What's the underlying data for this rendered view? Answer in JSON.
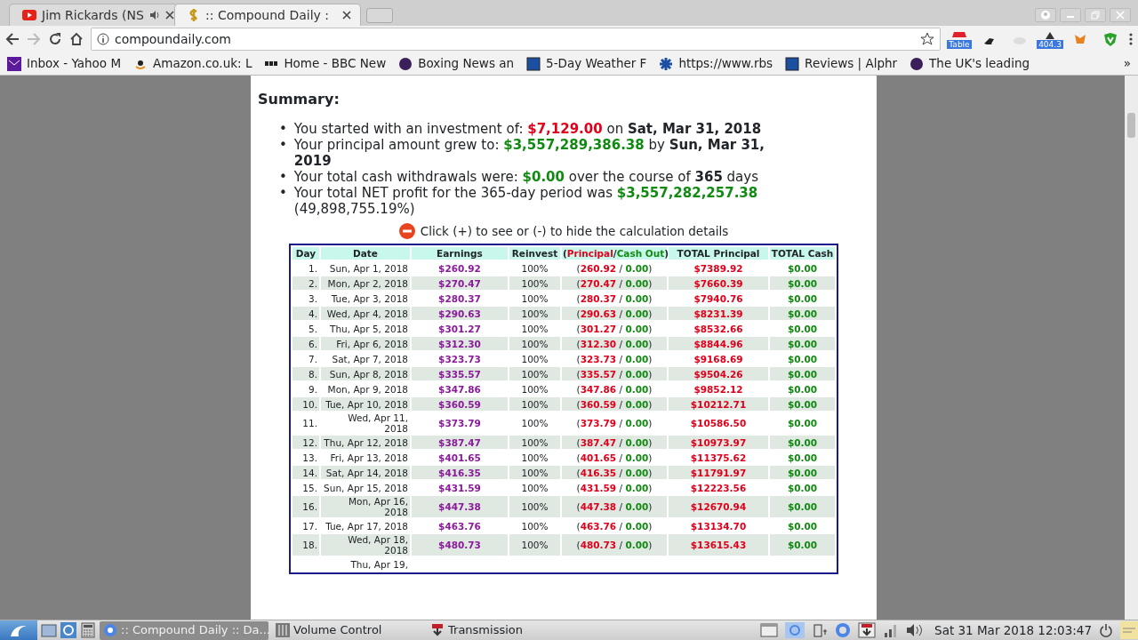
{
  "browser": {
    "tabs": [
      {
        "title": "Jim Rickards (NS",
        "selected": false,
        "kind": "video",
        "audio": true
      },
      {
        "title": ":: Compound Daily :",
        "selected": true,
        "kind": "dollar",
        "audio": false
      }
    ],
    "address": "compoundaily.com",
    "extension_badges": [
      "Table",
      "404.3"
    ],
    "bookmarks": [
      {
        "title": "Inbox - Yahoo M",
        "kind": "mail"
      },
      {
        "title": "Amazon.co.uk: L",
        "kind": "amazon"
      },
      {
        "title": "Home - BBC New",
        "kind": "bbc"
      },
      {
        "title": "Boxing News an",
        "kind": "round"
      },
      {
        "title": "5-Day Weather F",
        "kind": "square"
      },
      {
        "title": "https://www.rbs",
        "kind": "star"
      },
      {
        "title": "Reviews | Alphr",
        "kind": "square"
      },
      {
        "title": "The UK's leading",
        "kind": "round"
      }
    ],
    "more": "»"
  },
  "summary": {
    "title": "Summary:",
    "marker": "•",
    "items": [
      [
        {
          "text": "You started with an investment of: ",
          "kind": "plain"
        },
        {
          "text": "$7,129.00",
          "kind": "red"
        },
        {
          "text": " on ",
          "kind": "plain"
        },
        {
          "text": "Sat, Mar 31, 2018",
          "kind": "bold"
        }
      ],
      [
        {
          "text": "Your principal amount grew to: ",
          "kind": "plain"
        },
        {
          "text": "$3,557,289,386.38",
          "kind": "green"
        },
        {
          "text": " by ",
          "kind": "plain"
        },
        {
          "text": "Sun, Mar 31, 2019",
          "kind": "bold"
        }
      ],
      [
        {
          "text": "Your total cash withdrawals were: ",
          "kind": "plain"
        },
        {
          "text": "$0.00",
          "kind": "green"
        },
        {
          "text": " over the course of ",
          "kind": "plain"
        },
        {
          "text": "365",
          "kind": "bold"
        },
        {
          "text": " days",
          "kind": "plain"
        }
      ],
      [
        {
          "text": "Your total NET profit for the 365-day period was ",
          "kind": "plain"
        },
        {
          "text": "$3,557,282,257.38",
          "kind": "green"
        },
        {
          "text": " (49,898,755.19%)",
          "kind": "plain"
        }
      ]
    ]
  },
  "toggle": {
    "text": "Click (+) to see or (-) to hide the calculation details",
    "expanded": true
  },
  "table": {
    "columns": [
      {
        "label": "Day"
      },
      {
        "label": "Date"
      },
      {
        "label": "Earnings"
      },
      {
        "label": "Reinvest"
      },
      {
        "parts": [
          {
            "text": "(",
            "kind": "plain"
          },
          {
            "text": "Principal",
            "kind": "red"
          },
          {
            "text": "/",
            "kind": "plain"
          },
          {
            "text": "Cash Out",
            "kind": "green"
          },
          {
            "text": ")",
            "kind": "plain"
          }
        ]
      },
      {
        "label": "TOTAL Principal"
      },
      {
        "label": "TOTAL Cash"
      }
    ],
    "rows": [
      {
        "day": "1.",
        "date": "Sun, Apr 1, 2018",
        "earnings": "$260.92",
        "reinvest": "100%",
        "split": [
          "(",
          "260.92",
          " / ",
          "0.00",
          ")"
        ],
        "total_principal": "$7389.92",
        "total_cash": "$0.00"
      },
      {
        "day": "2.",
        "date": "Mon, Apr 2, 2018",
        "earnings": "$270.47",
        "reinvest": "100%",
        "split": [
          "(",
          "270.47",
          " / ",
          "0.00",
          ")"
        ],
        "total_principal": "$7660.39",
        "total_cash": "$0.00"
      },
      {
        "day": "3.",
        "date": "Tue, Apr 3, 2018",
        "earnings": "$280.37",
        "reinvest": "100%",
        "split": [
          "(",
          "280.37",
          " / ",
          "0.00",
          ")"
        ],
        "total_principal": "$7940.76",
        "total_cash": "$0.00"
      },
      {
        "day": "4.",
        "date": "Wed, Apr 4, 2018",
        "earnings": "$290.63",
        "reinvest": "100%",
        "split": [
          "(",
          "290.63",
          " / ",
          "0.00",
          ")"
        ],
        "total_principal": "$8231.39",
        "total_cash": "$0.00"
      },
      {
        "day": "5.",
        "date": "Thu, Apr 5, 2018",
        "earnings": "$301.27",
        "reinvest": "100%",
        "split": [
          "(",
          "301.27",
          " / ",
          "0.00",
          ")"
        ],
        "total_principal": "$8532.66",
        "total_cash": "$0.00"
      },
      {
        "day": "6.",
        "date": "Fri, Apr 6, 2018",
        "earnings": "$312.30",
        "reinvest": "100%",
        "split": [
          "(",
          "312.30",
          " / ",
          "0.00",
          ")"
        ],
        "total_principal": "$8844.96",
        "total_cash": "$0.00"
      },
      {
        "day": "7.",
        "date": "Sat, Apr 7, 2018",
        "earnings": "$323.73",
        "reinvest": "100%",
        "split": [
          "(",
          "323.73",
          " / ",
          "0.00",
          ")"
        ],
        "total_principal": "$9168.69",
        "total_cash": "$0.00"
      },
      {
        "day": "8.",
        "date": "Sun, Apr 8, 2018",
        "earnings": "$335.57",
        "reinvest": "100%",
        "split": [
          "(",
          "335.57",
          " / ",
          "0.00",
          ")"
        ],
        "total_principal": "$9504.26",
        "total_cash": "$0.00"
      },
      {
        "day": "9.",
        "date": "Mon, Apr 9, 2018",
        "earnings": "$347.86",
        "reinvest": "100%",
        "split": [
          "(",
          "347.86",
          " / ",
          "0.00",
          ")"
        ],
        "total_principal": "$9852.12",
        "total_cash": "$0.00"
      },
      {
        "day": "10.",
        "date": "Tue, Apr 10, 2018",
        "earnings": "$360.59",
        "reinvest": "100%",
        "split": [
          "(",
          "360.59",
          " / ",
          "0.00",
          ")"
        ],
        "total_principal": "$10212.71",
        "total_cash": "$0.00"
      },
      {
        "day": "11.",
        "date": "Wed, Apr 11, 2018",
        "earnings": "$373.79",
        "reinvest": "100%",
        "split": [
          "(",
          "373.79",
          " / ",
          "0.00",
          ")"
        ],
        "total_principal": "$10586.50",
        "total_cash": "$0.00"
      },
      {
        "day": "12.",
        "date": "Thu, Apr 12, 2018",
        "earnings": "$387.47",
        "reinvest": "100%",
        "split": [
          "(",
          "387.47",
          " / ",
          "0.00",
          ")"
        ],
        "total_principal": "$10973.97",
        "total_cash": "$0.00"
      },
      {
        "day": "13.",
        "date": "Fri, Apr 13, 2018",
        "earnings": "$401.65",
        "reinvest": "100%",
        "split": [
          "(",
          "401.65",
          " / ",
          "0.00",
          ")"
        ],
        "total_principal": "$11375.62",
        "total_cash": "$0.00"
      },
      {
        "day": "14.",
        "date": "Sat, Apr 14, 2018",
        "earnings": "$416.35",
        "reinvest": "100%",
        "split": [
          "(",
          "416.35",
          " / ",
          "0.00",
          ")"
        ],
        "total_principal": "$11791.97",
        "total_cash": "$0.00"
      },
      {
        "day": "15.",
        "date": "Sun, Apr 15, 2018",
        "earnings": "$431.59",
        "reinvest": "100%",
        "split": [
          "(",
          "431.59",
          " / ",
          "0.00",
          ")"
        ],
        "total_principal": "$12223.56",
        "total_cash": "$0.00"
      },
      {
        "day": "16.",
        "date": "Mon, Apr 16, 2018",
        "earnings": "$447.38",
        "reinvest": "100%",
        "split": [
          "(",
          "447.38",
          " / ",
          "0.00",
          ")"
        ],
        "total_principal": "$12670.94",
        "total_cash": "$0.00"
      },
      {
        "day": "17.",
        "date": "Tue, Apr 17, 2018",
        "earnings": "$463.76",
        "reinvest": "100%",
        "split": [
          "(",
          "463.76",
          " / ",
          "0.00",
          ")"
        ],
        "total_principal": "$13134.70",
        "total_cash": "$0.00"
      },
      {
        "day": "18.",
        "date": "Wed, Apr 18, 2018",
        "earnings": "$480.73",
        "reinvest": "100%",
        "split": [
          "(",
          "480.73",
          " / ",
          "0.00",
          ")"
        ],
        "total_principal": "$13615.43",
        "total_cash": "$0.00"
      },
      {
        "date": "Thu, Apr 19,"
      }
    ]
  },
  "taskbar": {
    "tasks": [
      {
        "title": ":: Compound Daily :: Da...",
        "kind": "browser",
        "selected": true
      },
      {
        "title": "Volume Control",
        "kind": "mixer",
        "selected": false
      },
      {
        "title": "Transmission",
        "kind": "download",
        "selected": false
      }
    ],
    "clock": "Sat 31 Mar 2018 12:03:47"
  }
}
